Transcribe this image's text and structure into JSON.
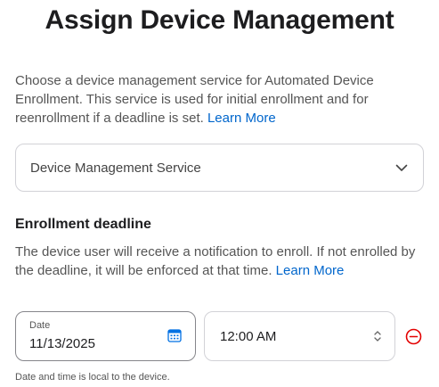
{
  "header": {
    "title": "Assign Device Management"
  },
  "intro": {
    "text": "Choose a device management service for Automated Device Enrollment. This service is used for initial enrollment and for reenrollment if a deadline is set. ",
    "link": "Learn More"
  },
  "service_select": {
    "label": "Device Management Service",
    "icon": "chevron-down-icon"
  },
  "deadline": {
    "heading": "Enrollment deadline",
    "text": "The device user will receive a notification to enroll. If not enrolled by the deadline, it will be enforced at that time. ",
    "link": "Learn More"
  },
  "date_field": {
    "caption": "Date",
    "value": "11/13/2025",
    "icon": "calendar-icon"
  },
  "time_field": {
    "value": "12:00 AM",
    "icon": "updown-chevron-icon"
  },
  "remove_button": {
    "icon": "remove-circle-icon",
    "color": "#e30000"
  },
  "footnote": "Date and time is local to the device.",
  "colors": {
    "accent": "#0066cc",
    "calendar_icon": "#0071e3",
    "danger": "#e30000"
  }
}
